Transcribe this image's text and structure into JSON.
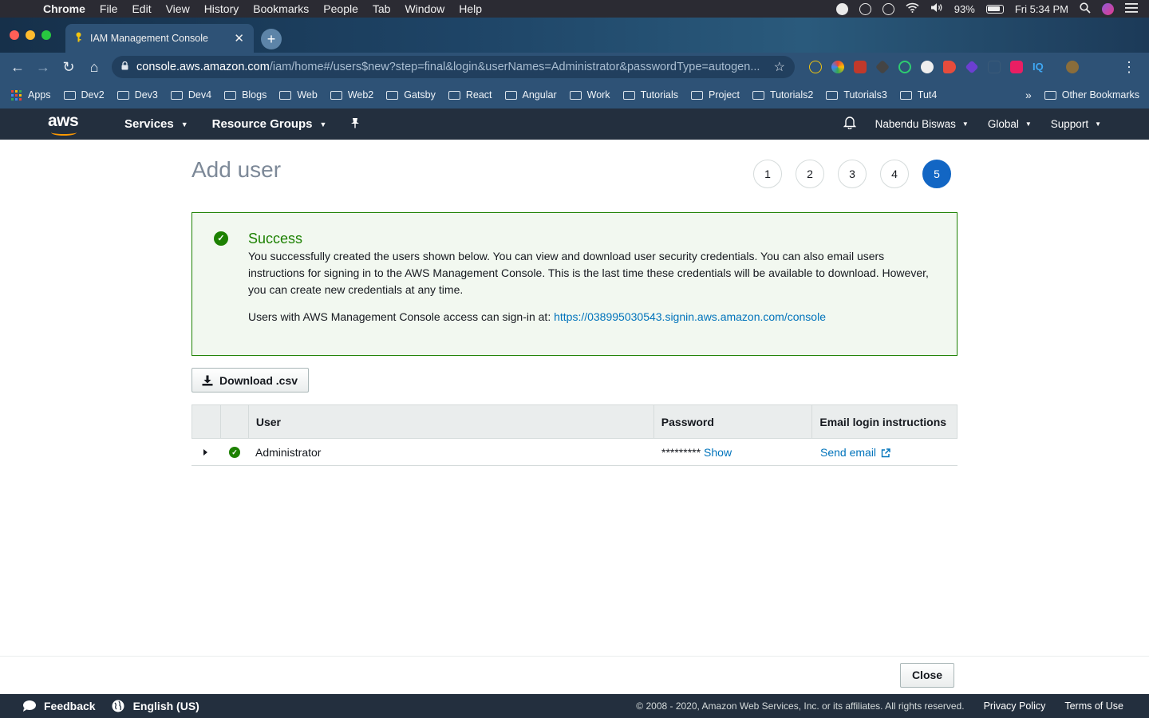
{
  "mac_menu": {
    "app": "Chrome",
    "items": [
      "File",
      "Edit",
      "View",
      "History",
      "Bookmarks",
      "People",
      "Tab",
      "Window",
      "Help"
    ],
    "battery": "93%",
    "clock": "Fri 5:34 PM"
  },
  "browser": {
    "tab_title": "IAM Management Console",
    "url_host": "console.aws.amazon.com",
    "url_path": "/iam/home#/users$new?step=final&login&userNames=Administrator&passwordType=autogen...",
    "bookmarks": [
      "Dev2",
      "Dev3",
      "Dev4",
      "Blogs",
      "Web",
      "Web2",
      "Gatsby",
      "React",
      "Angular",
      "Work",
      "Tutorials",
      "Project",
      "Tutorials2",
      "Tutorials3",
      "Tut4"
    ],
    "apps_label": "Apps",
    "more_label": "»",
    "other_bookmarks": "Other Bookmarks"
  },
  "aws_nav": {
    "logo": "aws",
    "services": "Services",
    "resource_groups": "Resource Groups",
    "user": "Nabendu Biswas",
    "region": "Global",
    "support": "Support"
  },
  "page": {
    "title": "Add user",
    "steps": [
      "1",
      "2",
      "3",
      "4",
      "5"
    ],
    "active_step": 5
  },
  "alert": {
    "title": "Success",
    "message": "You successfully created the users shown below. You can view and download user security credentials. You can also email users instructions for signing in to the AWS Management Console. This is the last time these credentials will be available to download. However, you can create new credentials at any time.",
    "signin_prefix": "Users with AWS Management Console access can sign-in at: ",
    "signin_url": "https://038995030543.signin.aws.amazon.com/console"
  },
  "download_label": "Download .csv",
  "table": {
    "headers": [
      "",
      "",
      "User",
      "Password",
      "Email login instructions"
    ],
    "rows": [
      {
        "user": "Administrator",
        "password_mask": "*********",
        "password_action": "Show",
        "email_action": "Send email"
      }
    ]
  },
  "close_label": "Close",
  "footer": {
    "feedback": "Feedback",
    "language": "English (US)",
    "copyright": "© 2008 - 2020, Amazon Web Services, Inc. or its affiliates. All rights reserved.",
    "privacy": "Privacy Policy",
    "terms": "Terms of Use"
  },
  "colors": {
    "aws_nav_bg": "#232f3e",
    "aws_orange": "#ff9900",
    "success_green": "#1d8102",
    "link_blue": "#0073bb",
    "active_step": "#1266c4"
  }
}
